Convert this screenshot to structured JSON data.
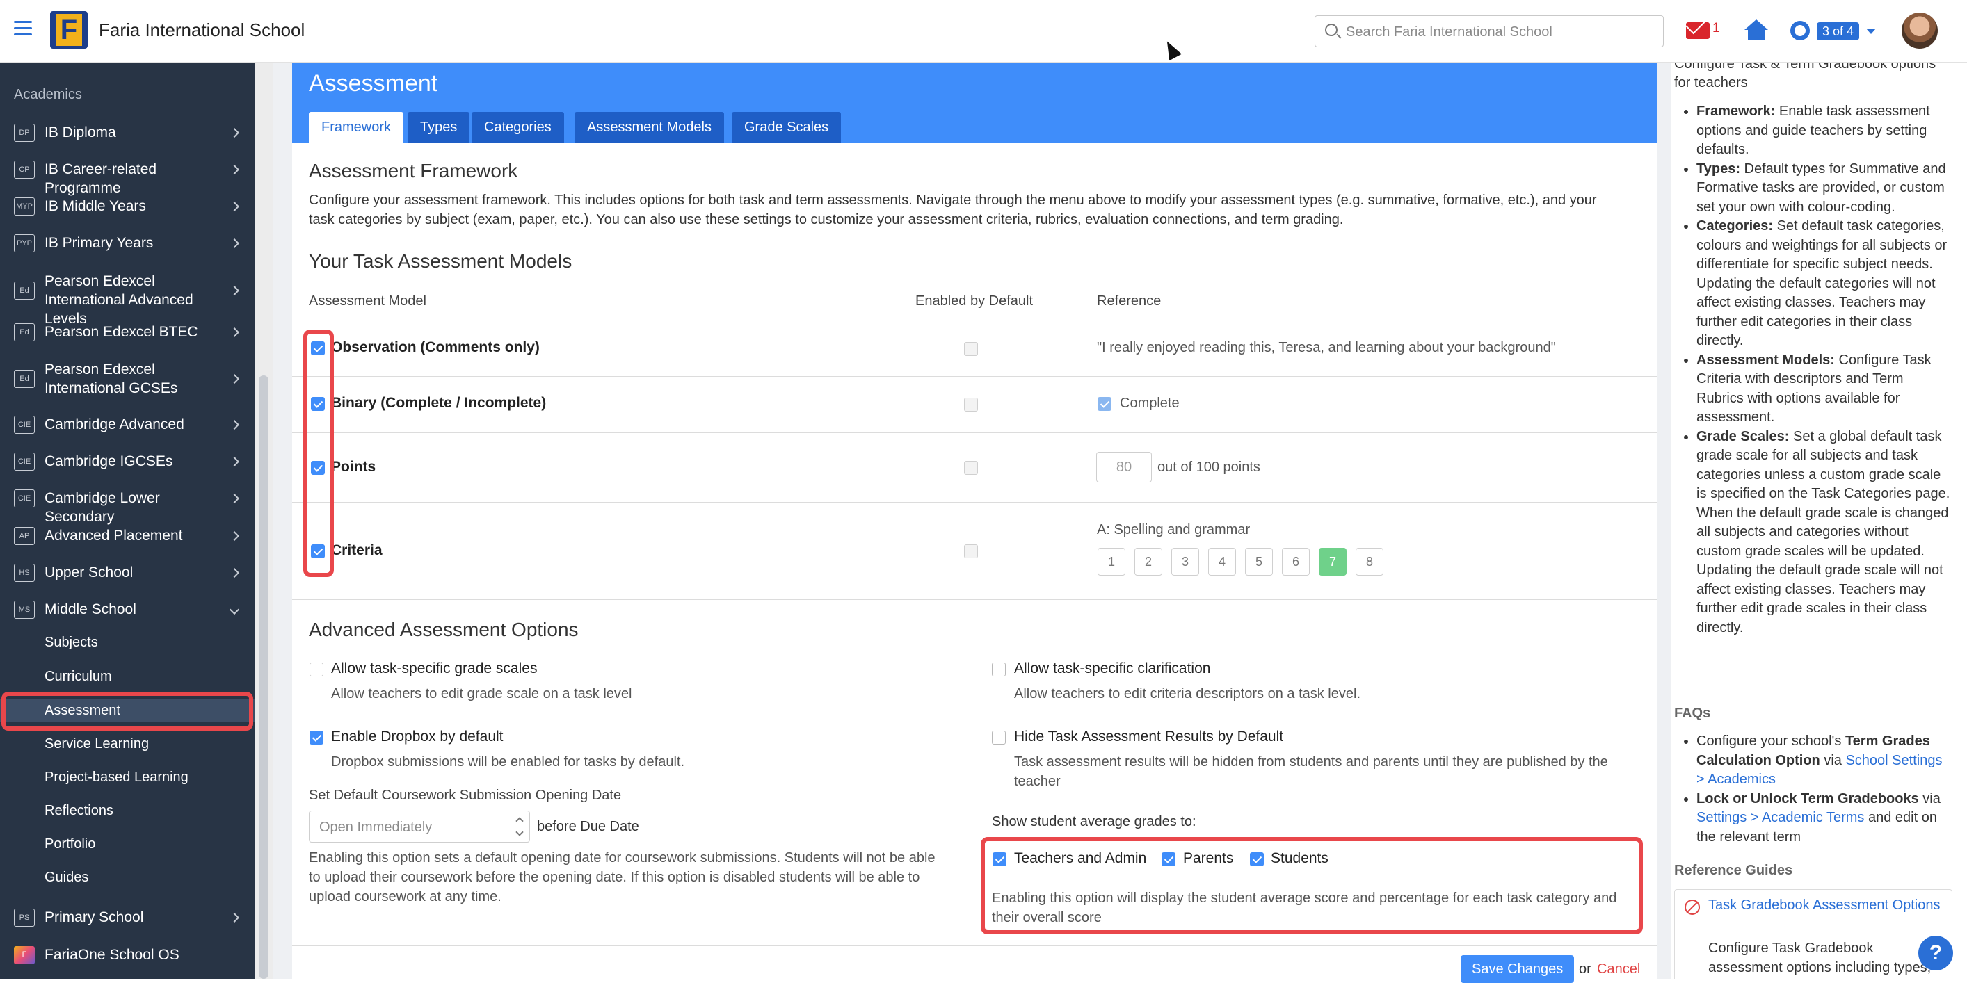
{
  "topbar": {
    "school_name": "Faria International School",
    "search_placeholder": "Search Faria International School",
    "mail_count": "1",
    "pager": "3 of 4"
  },
  "sidebar": {
    "heading": "Academics",
    "items": [
      {
        "badge": "DP",
        "label": "IB Diploma"
      },
      {
        "badge": "CP",
        "label": "IB Career-related Programme"
      },
      {
        "badge": "MYP",
        "label": "IB Middle Years"
      },
      {
        "badge": "PYP",
        "label": "IB Primary Years"
      },
      {
        "badge": "Ed",
        "label": "Pearson Edexcel International Advanced Levels"
      },
      {
        "badge": "Ed",
        "label": "Pearson Edexcel BTEC"
      },
      {
        "badge": "Ed",
        "label": "Pearson Edexcel International GCSEs"
      },
      {
        "badge": "CIE",
        "label": "Cambridge Advanced"
      },
      {
        "badge": "CIE",
        "label": "Cambridge IGCSEs"
      },
      {
        "badge": "CIE",
        "label": "Cambridge Lower Secondary"
      },
      {
        "badge": "AP",
        "label": "Advanced Placement"
      },
      {
        "badge": "HS",
        "label": "Upper School"
      },
      {
        "badge": "MS",
        "label": "Middle School"
      }
    ],
    "sub_items": [
      "Subjects",
      "Curriculum",
      "Assessment",
      "Service Learning",
      "Project-based Learning",
      "Reflections",
      "Portfolio",
      "Guides"
    ],
    "bottom_items": [
      {
        "badge": "PS",
        "label": "Primary School"
      },
      {
        "badge": "F",
        "label": "FariaOne School OS"
      }
    ]
  },
  "panel": {
    "title": "Assessment",
    "tabs": [
      "Framework",
      "Types",
      "Categories",
      "Assessment Models",
      "Grade Scales"
    ],
    "framework_heading": "Assessment Framework",
    "framework_desc_1": "Configure your assessment framework. This includes options for both task and term assessments. Navigate through the menu above to modify your assessment types (e.g. summative, formative, etc.), and your",
    "framework_desc_2": "task categories by subject (exam, paper, etc.). You can also use these settings to customize your assessment criteria, rubrics, evaluation connections, and term grading.",
    "models_heading": "Your Task Assessment Models",
    "col_model": "Assessment Model",
    "col_enabled": "Enabled by Default",
    "col_reference": "Reference",
    "models": [
      {
        "label": "Observation (Comments only)",
        "reference": "\"I really enjoyed reading this, Teresa, and learning about your background\""
      },
      {
        "label": "Binary (Complete / Incomplete)",
        "reference": "Complete"
      },
      {
        "label": "Points",
        "reference_value": "80",
        "reference": "out of 100 points"
      },
      {
        "label": "Criteria",
        "reference": "A: Spelling and grammar",
        "scale": [
          "1",
          "2",
          "3",
          "4",
          "5",
          "6",
          "7",
          "8"
        ],
        "selected": "7"
      }
    ],
    "advanced_heading": "Advanced Assessment Options",
    "opt_grade_scales": "Allow task-specific grade scales",
    "opt_grade_scales_desc": "Allow teachers to edit grade scale on a task level",
    "opt_clarification": "Allow task-specific clarification",
    "opt_clarification_desc": "Allow teachers to edit criteria descriptors on a task level.",
    "opt_dropbox": "Enable Dropbox by default",
    "opt_dropbox_desc": "Dropbox submissions will be enabled for tasks by default.",
    "opt_hide": "Hide Task Assessment Results by Default",
    "opt_hide_desc_1": "Task assessment results will be hidden from students and parents until they are published by the",
    "opt_hide_desc_2": "teacher",
    "opening_label": "Set Default Coursework Submission Opening Date",
    "opening_placeholder": "Open Immediately",
    "before_due": "before Due Date",
    "opening_desc_1": "Enabling this option sets a default opening date for coursework submissions. Students will not be able",
    "opening_desc_2": "to upload their coursework before the opening date. If this option is disabled students will be able to",
    "opening_desc_3": "upload coursework at any time.",
    "show_avg_label": "Show student average grades to:",
    "avg_teachers": "Teachers and Admin",
    "avg_parents": "Parents",
    "avg_students": "Students",
    "avg_desc_1": "Enabling this option will display the student average score and percentage for each task category and",
    "avg_desc_2": "their overall score",
    "save": "Save Changes",
    "or": "or",
    "cancel": "Cancel"
  },
  "help": {
    "intro": "Configure Task & Term Gradebook options for teachers",
    "items": [
      {
        "b": "Framework:",
        "t": " Enable task assessment options and guide teachers by setting defaults."
      },
      {
        "b": "Types:",
        "t": " Default types for Summative and Formative tasks are provided, or custom set your own with colour-coding."
      },
      {
        "b": "Categories:",
        "t": " Set default task categories, colours and weightings for all subjects or differentiate for specific subject needs. Updating the default categories will not affect existing classes. Teachers may further edit categories in their class directly."
      },
      {
        "b": "Assessment Models:",
        "t": " Configure Task Criteria with descriptors and Term Rubrics with options available for assessment."
      },
      {
        "b": "Grade Scales:",
        "t": " Set a global default task grade scale for all subjects and task categories unless a custom grade scale is specified on the Task Categories page. When the default grade scale is changed all subjects and categories without custom grade scales will be updated. Updating the default grade scale will not affect existing classes. Teachers may further edit grade scales in their class directly."
      }
    ],
    "faqs": "FAQs",
    "faq_1_pre": "Configure your school's ",
    "faq_1_b": "Term Grades Calculation Option",
    "faq_1_mid": " via ",
    "faq_1_link": "School Settings > Academics",
    "faq_2_b": "Lock or Unlock Term Gradebooks",
    "faq_2_mid": " via ",
    "faq_2_link": "Settings > Academic Terms",
    "faq_2_post": " and edit on the relevant term",
    "ref_heading": "Reference Guides",
    "ref_title": "Task Gradebook Assessment Options",
    "ref_desc": "Configure Task Gradebook assessment options including types,"
  }
}
